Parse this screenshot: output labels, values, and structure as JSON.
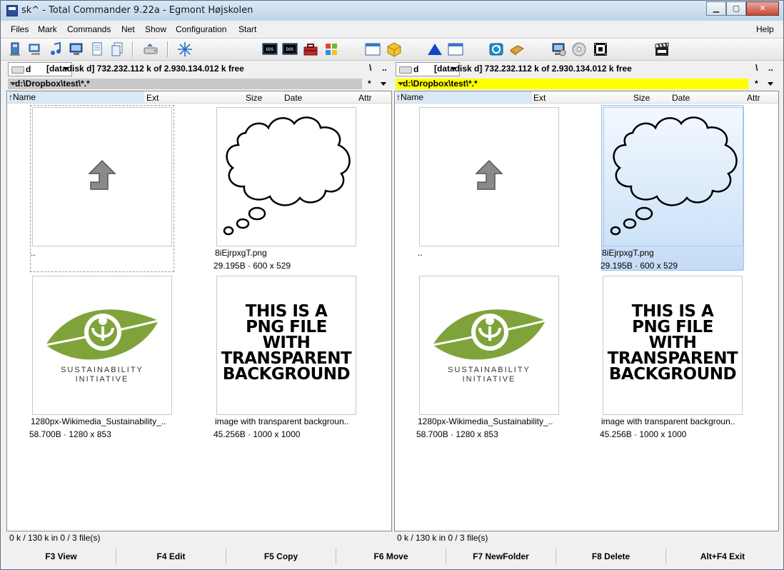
{
  "window": {
    "title": "sk^ - Total Commander 9.22a - Egmont Højskolen",
    "buttons": {
      "minimize": "▁",
      "maximize": "▢",
      "close": "✕"
    }
  },
  "menu": [
    {
      "label": "Files"
    },
    {
      "label": "Mark"
    },
    {
      "label": "Commands"
    },
    {
      "label": "Net"
    },
    {
      "label": "Show"
    },
    {
      "label": "Configuration"
    },
    {
      "label": "Start"
    },
    {
      "label": "Help"
    }
  ],
  "toolbar_icons": [
    "computer-icon",
    "network-icon",
    "music-icon",
    "monitor-icon",
    "document-icon",
    "copy-icon",
    "drive-icon",
    "snowflake-icon",
    "dos-icon",
    "dos2-icon",
    "toolbox-icon",
    "windows-icon",
    "window-icon",
    "package-icon",
    "triangle-icon",
    "window2-icon",
    "refresh-icon",
    "book-icon",
    "monitor-settings-icon",
    "cd-icon",
    "film-icon",
    "clapper-icon"
  ],
  "left": {
    "drive_letter": "d",
    "drive_info": "[datadisk d]  732.232.112 k of 2.930.134.012 k free",
    "root_btn": "\\",
    "up_btn": "..",
    "path": "d:\\Dropbox\\test\\*.*",
    "star_btn": "*",
    "columns": {
      "name": "Name",
      "ext": "Ext",
      "size": "Size",
      "date": "Date",
      "attr": "Attr"
    },
    "status": "0 k / 130 k in 0 / 3 file(s)"
  },
  "right": {
    "drive_letter": "d",
    "drive_info": "[datadisk d]  732.232.112 k of 2.930.134.012 k free",
    "root_btn": "\\",
    "up_btn": "..",
    "path": "d:\\Dropbox\\test\\*.*",
    "star_btn": "*",
    "columns": {
      "name": "Name",
      "ext": "Ext",
      "size": "Size",
      "date": "Date",
      "attr": "Attr"
    },
    "status": "0 k / 130 k in 0 / 3 file(s)"
  },
  "files": [
    {
      "name": "..",
      "meta": ""
    },
    {
      "name": "8iEjrpxgT.png",
      "meta": "29.195B · 600 x 529"
    },
    {
      "name": "1280px-Wikimedia_Sustainability_..",
      "meta": "58.700B · 1280 x 853"
    },
    {
      "name": "image with transparent backgroun..",
      "meta": "45.256B · 1000 x 1000"
    }
  ],
  "thumb_text": {
    "logo_line1": "SUSTAINABILITY",
    "logo_line2": "INITIATIVE",
    "png_lines": [
      "THIS IS A",
      "PNG FILE",
      "WITH",
      "TRANSPARENT",
      "BACKGROUND"
    ]
  },
  "fnkeys": [
    {
      "label": "F3 View"
    },
    {
      "label": "F4 Edit"
    },
    {
      "label": "F5 Copy"
    },
    {
      "label": "F6 Move"
    },
    {
      "label": "F7 NewFolder"
    },
    {
      "label": "F8 Delete"
    },
    {
      "label": "Alt+F4 Exit"
    }
  ],
  "colors": {
    "active_path_bg": "#ffff00",
    "inactive_path_bg": "#c8c8c8",
    "selection": "#c5dcf6",
    "leaf_green": "#7fa33a"
  }
}
